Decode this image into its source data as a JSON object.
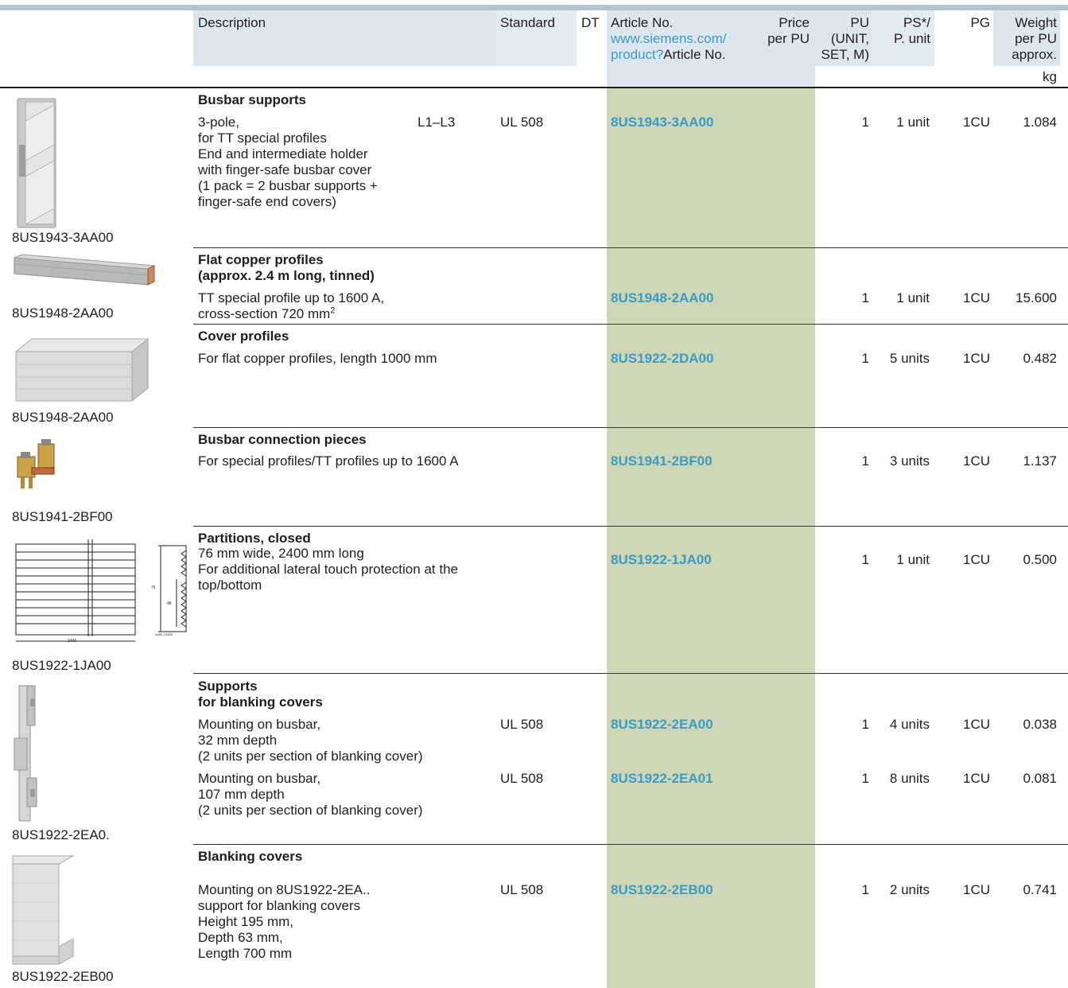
{
  "header": {
    "description": "Description",
    "standard": "Standard",
    "dt": "DT",
    "article_no": "Article No.",
    "article_link1": "www.siemens.com/",
    "article_link2": "product?",
    "article_link3": "Article No.",
    "price1": "Price",
    "price2": "per PU",
    "pu1": "PU",
    "pu2": "(UNIT,",
    "pu3": "SET, M)",
    "ps1": "PS*/",
    "ps2": "P. unit",
    "pg": "PG",
    "weight1": "Weight",
    "weight2": "per PU",
    "weight3": "approx.",
    "unit": "kg"
  },
  "sections": [
    {
      "title": "Busbar supports",
      "caption": "8US1943-3AA00",
      "rows": [
        {
          "desc": [
            "3-pole,",
            "for TT special profiles",
            "End and intermediate holder",
            "with finger-safe busbar cover",
            "(1 pack = 2 busbar supports +",
            "finger-safe end covers)"
          ],
          "extra": "L1–L3",
          "standard": "UL 508",
          "article": "8US1943-3AA00",
          "pu": "1",
          "ps": "1 unit",
          "pg": "1CU",
          "weight": "1.084"
        }
      ]
    },
    {
      "title_lines": [
        "Flat copper profiles",
        "(approx. 2.4 m long, tinned)"
      ],
      "caption": "8US1948-2AA00",
      "rows": [
        {
          "desc": [
            "TT special profile up to 1600 A,",
            "cross-section 720 mm"
          ],
          "sup": "2",
          "article": "8US1948-2AA00",
          "pu": "1",
          "ps": "1 unit",
          "pg": "1CU",
          "weight": "15.600"
        }
      ]
    },
    {
      "title": "Cover profiles",
      "caption": "8US1948-2AA00",
      "rows": [
        {
          "desc": [
            "For flat copper profiles, length 1000 mm"
          ],
          "article": "8US1922-2DA00",
          "pu": "1",
          "ps": "5 units",
          "pg": "1CU",
          "weight": "0.482"
        }
      ]
    },
    {
      "title": "Busbar connection pieces",
      "caption": "8US1941-2BF00",
      "rows": [
        {
          "desc": [
            "For special profiles/TT profiles up to 1600 A"
          ],
          "article": "8US1941-2BF00",
          "pu": "1",
          "ps": "3 units",
          "pg": "1CU",
          "weight": "1.137"
        }
      ]
    },
    {
      "title": "Partitions, closed",
      "caption": "8US1922-1JA00",
      "drawing": {
        "len": "2400",
        "h1": "76",
        "h2": "48",
        "ref": "4080_01825"
      },
      "rows": [
        {
          "desc": [
            "76 mm wide, 2400 mm long",
            "For additional lateral touch protection at the",
            "top/bottom"
          ],
          "article": "8US1922-1JA00",
          "pu": "1",
          "ps": "1 unit",
          "pg": "1CU",
          "weight": "0.500"
        }
      ]
    },
    {
      "title_lines": [
        "Supports",
        "for blanking covers"
      ],
      "caption": "8US1922-2EA0.",
      "rows": [
        {
          "desc": [
            "Mounting on busbar,",
            "32 mm depth",
            "(2 units per section of blanking cover)"
          ],
          "standard": "UL 508",
          "article": "8US1922-2EA00",
          "pu": "1",
          "ps": "4 units",
          "pg": "1CU",
          "weight": "0.038"
        },
        {
          "desc": [
            "Mounting on busbar,",
            "107 mm depth",
            "(2 units per section of blanking cover)"
          ],
          "standard": "UL 508",
          "article": "8US1922-2EA01",
          "pu": "1",
          "ps": "8 units",
          "pg": "1CU",
          "weight": "0.081"
        }
      ]
    },
    {
      "title": "Blanking covers",
      "caption": "8US1922-2EB00",
      "rows": [
        {
          "desc": [
            "Mounting on 8US1922-2EA..",
            "support for blanking covers",
            "Height 195 mm,",
            "Depth 63 mm,",
            "Length 700 mm"
          ],
          "standard": "UL 508",
          "article": "8US1922-2EB00",
          "pu": "1",
          "ps": "2 units",
          "pg": "1CU",
          "weight": "0.741"
        }
      ]
    }
  ],
  "colors": {
    "accent": "#3d9ac4",
    "highlight": "#cbd7b6",
    "header": "#dde6ef"
  }
}
